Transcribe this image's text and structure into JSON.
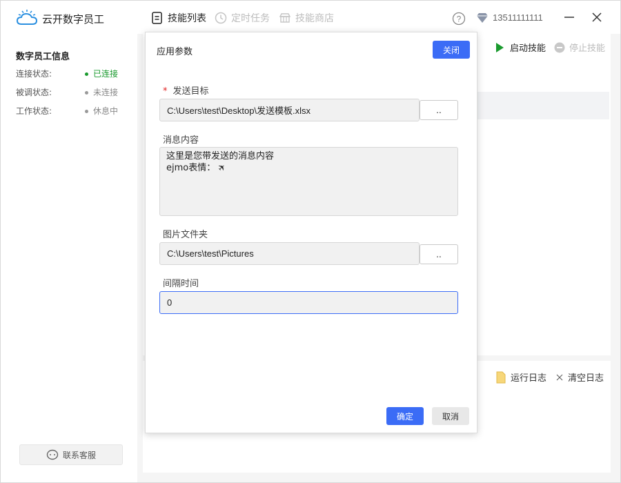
{
  "app": {
    "title": "云开数字员工",
    "nav": [
      {
        "label": "技能列表",
        "icon": "list-icon",
        "active": true
      },
      {
        "label": "定时任务",
        "icon": "clock-icon",
        "active": false
      },
      {
        "label": "技能商店",
        "icon": "store-icon",
        "active": false
      }
    ],
    "user_phone": "13511111111"
  },
  "sidebar": {
    "title": "数字员工信息",
    "rows": [
      {
        "label": "连接状态:",
        "value": "已连接",
        "status_color": "#1a9a2e"
      },
      {
        "label": "被调状态:",
        "value": "未连接",
        "status_color": "#888888"
      },
      {
        "label": "工作状态:",
        "value": "休息中",
        "status_color": "#888888"
      }
    ],
    "contact_label": "联系客服"
  },
  "toolbar": {
    "start_label": "启动技能",
    "stop_label": "停止技能",
    "log_label": "运行日志",
    "clear_label": "清空日志"
  },
  "dialog": {
    "title": "应用参数",
    "close_label": "关闭",
    "fields": {
      "target": {
        "label": "发送目标",
        "required_mark": "*",
        "value": "C:\\Users\\test\\Desktop\\发送模板.xlsx",
        "browse_label": ".."
      },
      "message": {
        "label": "消息内容",
        "line1": "这里是您带发送的消息内容",
        "line2": "ejmo表情： 🛪"
      },
      "images": {
        "label": "图片文件夹",
        "value": "C:\\Users\\test\\Pictures",
        "browse_label": ".."
      },
      "interval": {
        "label": "间隔时间",
        "value": "0"
      }
    },
    "ok_label": "确定",
    "cancel_label": "取消"
  },
  "colors": {
    "accent": "#3b6cf6",
    "connected": "#1a9a2e",
    "required": "#e02020"
  }
}
